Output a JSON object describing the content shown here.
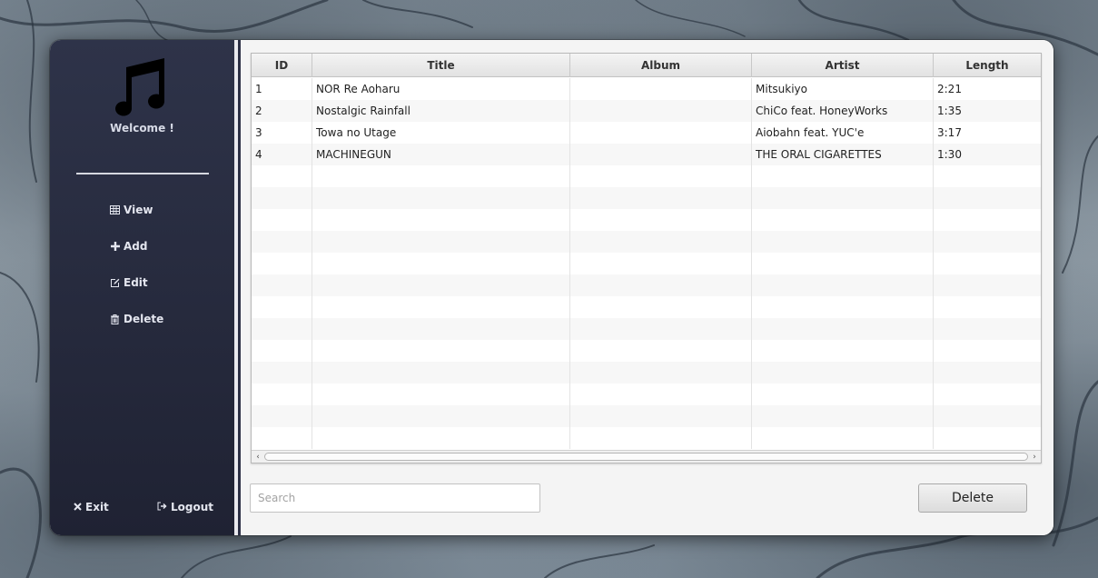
{
  "sidebar": {
    "welcome": "Welcome !",
    "nav": [
      {
        "label": "View",
        "icon": "table-icon"
      },
      {
        "label": "Add",
        "icon": "plus-icon"
      },
      {
        "label": "Edit",
        "icon": "edit-icon"
      },
      {
        "label": "Delete",
        "icon": "trash-icon"
      }
    ],
    "exit_label": "Exit",
    "logout_label": "Logout"
  },
  "table": {
    "columns": [
      "ID",
      "Title",
      "Album",
      "Artist",
      "Length"
    ],
    "rows": [
      [
        "1",
        "NOR Re Aoharu",
        "",
        "Mitsukiyo",
        "2:21"
      ],
      [
        "2",
        "Nostalgic Rainfall",
        "",
        "ChiCo feat. HoneyWorks",
        "1:35"
      ],
      [
        "3",
        "Towa no Utage",
        "",
        "Aiobahn feat. YUC'e",
        "3:17"
      ],
      [
        "4",
        "MACHINEGUN",
        "",
        "THE ORAL CIGARETTES",
        "1:30"
      ]
    ],
    "empty_rows": 13
  },
  "search": {
    "value": "",
    "placeholder": "Search"
  },
  "actions": {
    "delete_label": "Delete"
  },
  "colors": {
    "sidebar": "#2a2e43",
    "content": "#f4f4f4",
    "row_alt": "#f7f7f7"
  }
}
